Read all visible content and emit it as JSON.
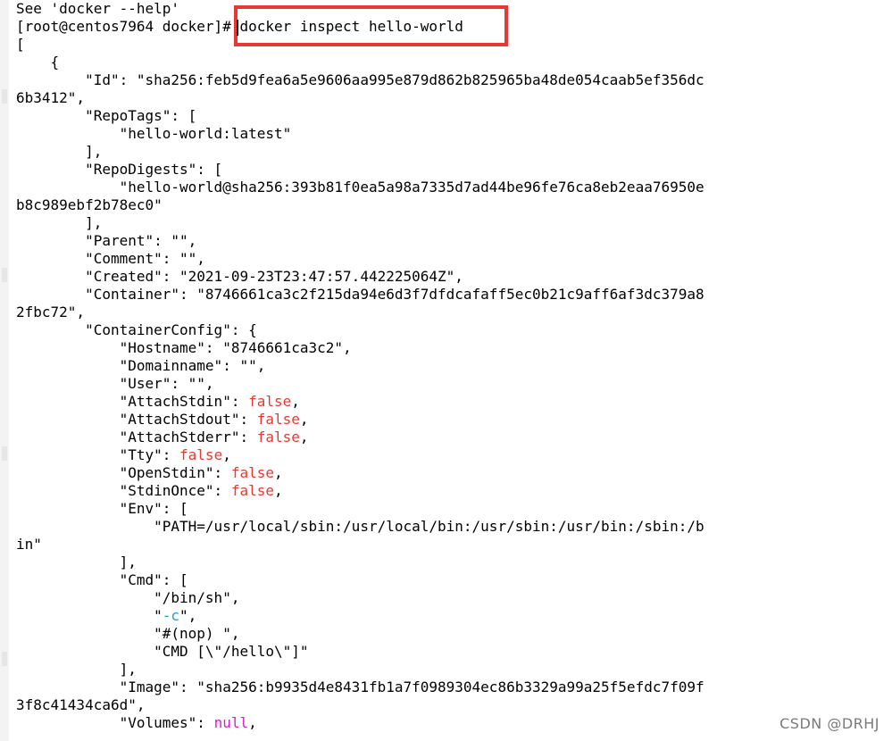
{
  "terminal": {
    "lines": [
      {
        "text": "See 'docker --help'"
      },
      {
        "text": "[root@centos7964 docker]# docker inspect hello-world"
      },
      {
        "text": "["
      },
      {
        "text": "    {"
      },
      {
        "text": "        \"Id\": \"sha256:feb5d9fea6a5e9606aa995e879d862b825965ba48de054caab5ef356dc"
      },
      {
        "text": "6b3412\","
      },
      {
        "text": "        \"RepoTags\": ["
      },
      {
        "text": "            \"hello-world:latest\""
      },
      {
        "text": "        ],"
      },
      {
        "text": "        \"RepoDigests\": ["
      },
      {
        "text": "            \"hello-world@sha256:393b81f0ea5a98a7335d7ad44be96fe76ca8eb2eaa76950e"
      },
      {
        "text": "b8c989ebf2b78ec0\""
      },
      {
        "text": "        ],"
      },
      {
        "text": "        \"Parent\": \"\","
      },
      {
        "text": "        \"Comment\": \"\","
      },
      {
        "text": "        \"Created\": \"2021-09-23T23:47:57.442225064Z\","
      },
      {
        "text": "        \"Container\": \"8746661ca3c2f215da94e6d3f7dfdcafaff5ec0b21c9aff6af3dc379a8"
      },
      {
        "text": "2fbc72\","
      },
      {
        "text": "        \"ContainerConfig\": {"
      },
      {
        "text": "            \"Hostname\": \"8746661ca3c2\","
      },
      {
        "text": "            \"Domainname\": \"\","
      },
      {
        "text": "            \"User\": \"\","
      },
      {
        "prefix": "            \"AttachStdin\": ",
        "value": "false",
        "suffix": ","
      },
      {
        "prefix": "            \"AttachStdout\": ",
        "value": "false",
        "suffix": ","
      },
      {
        "prefix": "            \"AttachStderr\": ",
        "value": "false",
        "suffix": ","
      },
      {
        "prefix": "            \"Tty\": ",
        "value": "false",
        "suffix": ","
      },
      {
        "prefix": "            \"OpenStdin\": ",
        "value": "false",
        "suffix": ","
      },
      {
        "prefix": "            \"StdinOnce\": ",
        "value": "false",
        "suffix": ","
      },
      {
        "text": "            \"Env\": ["
      },
      {
        "text": "                \"PATH=/usr/local/sbin:/usr/local/bin:/usr/sbin:/usr/bin:/sbin:/b"
      },
      {
        "text": "in\""
      },
      {
        "text": "            ],"
      },
      {
        "text": "            \"Cmd\": ["
      },
      {
        "text": "                \"/bin/sh\","
      },
      {
        "prefix": "                \"",
        "value": "-c",
        "suffix": "\","
      },
      {
        "text": "                \"#(nop) \","
      },
      {
        "text": "                \"CMD [\\\"/hello\\\"]\""
      },
      {
        "text": "            ],"
      },
      {
        "text": "            \"Image\": \"sha256:b9935d4e8431fb1a7f0989304ec86b3329a99a25f5efdc7f09f"
      },
      {
        "text": "3f8c41434ca6d\","
      },
      {
        "prefix": "            \"Volumes\": ",
        "value": "null",
        "suffix": ","
      }
    ]
  },
  "watermark": "CSDN @DRHJ",
  "colors": {
    "false": "#e8392e",
    "null": "#d91bd4",
    "option": "#1a9ed6",
    "highlight": "#e53935"
  }
}
